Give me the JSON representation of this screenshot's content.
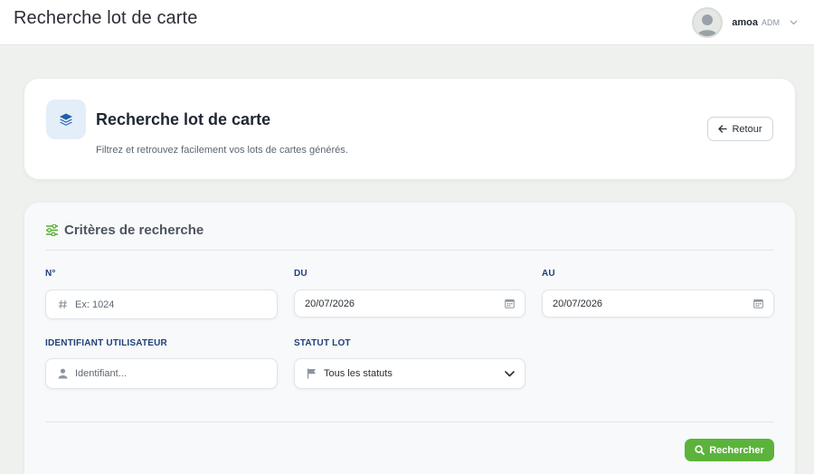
{
  "topbar": {
    "title": "Recherche lot de carte",
    "user": {
      "name": "amoa",
      "role": "ADM"
    }
  },
  "header": {
    "title": "Recherche lot de carte",
    "subtitle": "Filtrez et retrouvez facilement vos lots de cartes générés.",
    "back_label": "Retour"
  },
  "criteria": {
    "title": "Critères de recherche",
    "fields": {
      "numero": {
        "label": "N°",
        "placeholder": "Ex: 1024"
      },
      "du": {
        "label": "DU",
        "value": "20/07/2026"
      },
      "au": {
        "label": "AU",
        "value": "20/07/2026"
      },
      "identifiant": {
        "label": "IDENTIFIANT UTILISATEUR",
        "placeholder": "Identifiant..."
      },
      "statut": {
        "label": "STATUT LOT",
        "value": "Tous les statuts"
      }
    },
    "search_label": "Rechercher"
  },
  "colors": {
    "accent_green": "#5bb33c",
    "label_blue": "#21407a",
    "icon_blue": "#1f5fa8"
  },
  "icons": {
    "header": "layers-icon",
    "criteria": "sliders-icon",
    "numero": "hash-icon",
    "date": "calendar-icon",
    "user": "user-icon",
    "status": "flag-icon",
    "search": "search-icon"
  }
}
